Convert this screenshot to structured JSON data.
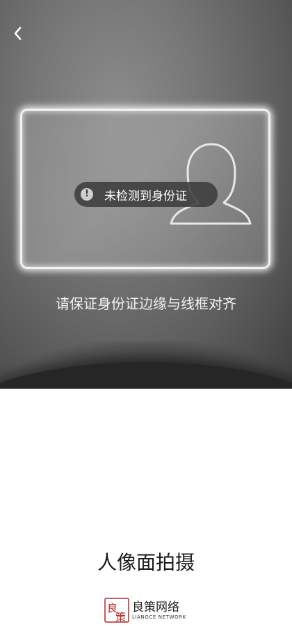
{
  "header": {
    "back_icon": "chevron-left-icon"
  },
  "camera": {
    "toast": {
      "icon": "exclamation-circle-icon",
      "text": "未检测到身份证"
    },
    "instruction": "请保证身份证边缘与线框对齐",
    "frame_icon": "person-silhouette-icon"
  },
  "footer": {
    "mode_title": "人像面拍摄",
    "brand": {
      "logo_chars": "良策",
      "name": "良策网络",
      "subtitle": "LIANGCE NETWORK"
    }
  },
  "colors": {
    "frame_border": "#f2f2f2",
    "toast_bg": "#3c3c3c",
    "brand_red": "#b3262a"
  }
}
